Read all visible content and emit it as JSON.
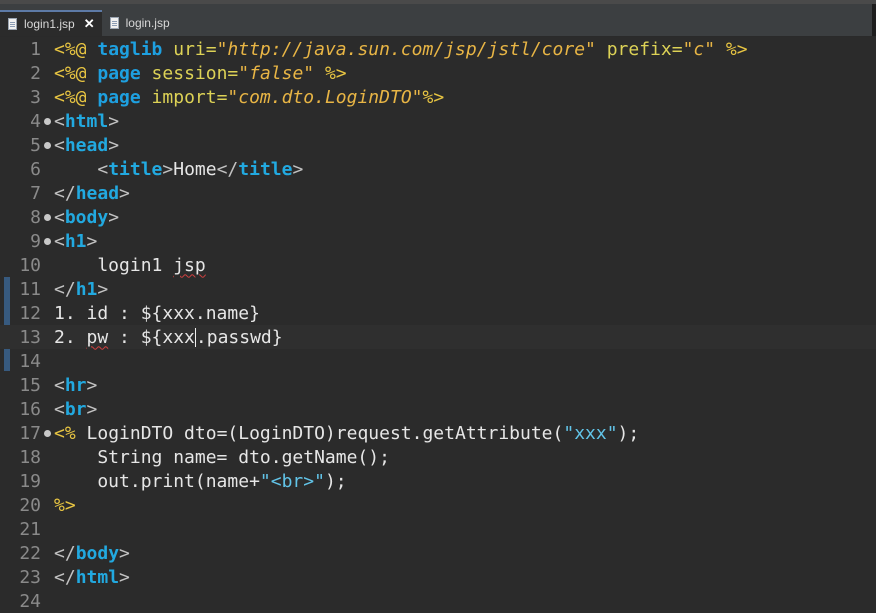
{
  "tabs": [
    {
      "label": "login1.jsp",
      "active": true,
      "close": "✕"
    },
    {
      "label": "login.jsp",
      "active": false
    }
  ],
  "colors": {
    "background": "#2b2b2b",
    "line_numbers": "#8a8a8a",
    "tag_keyword": "#22a9e0",
    "jsp_delimiter": "#e8c542",
    "attribute_value": "#e8b545"
  },
  "lines": [
    {
      "n": "1",
      "fold": false,
      "tokens": [
        [
          "t-jsp",
          "<%@ "
        ],
        [
          "t-kw",
          "taglib"
        ],
        [
          "t-attr",
          " uri="
        ],
        [
          "t-str",
          "\"http://java.sun.com/jsp/jstl/core\""
        ],
        [
          "t-attr",
          " prefix="
        ],
        [
          "t-str",
          "\"c\""
        ],
        [
          "t-jsp",
          " %>"
        ]
      ]
    },
    {
      "n": "2",
      "fold": false,
      "tokens": [
        [
          "t-jsp",
          "<%@ "
        ],
        [
          "t-kw",
          "page"
        ],
        [
          "t-attr",
          " session="
        ],
        [
          "t-str",
          "\"false\""
        ],
        [
          "t-jsp",
          " %>"
        ]
      ]
    },
    {
      "n": "3",
      "fold": false,
      "tokens": [
        [
          "t-jsp",
          "<%@ "
        ],
        [
          "t-kw",
          "page"
        ],
        [
          "t-attr",
          " import="
        ],
        [
          "t-str",
          "\"com.dto.LoginDTO\""
        ],
        [
          "t-jsp",
          "%>"
        ]
      ]
    },
    {
      "n": "4",
      "fold": true,
      "tokens": [
        [
          "t-tag",
          "<"
        ],
        [
          "t-el",
          "html"
        ],
        [
          "t-tag",
          ">"
        ]
      ]
    },
    {
      "n": "5",
      "fold": true,
      "tokens": [
        [
          "t-tag",
          "<"
        ],
        [
          "t-el",
          "head"
        ],
        [
          "t-tag",
          ">"
        ]
      ]
    },
    {
      "n": "6",
      "fold": false,
      "tokens": [
        [
          "t-txt",
          "    "
        ],
        [
          "t-tag",
          "<"
        ],
        [
          "t-el",
          "title"
        ],
        [
          "t-tag",
          ">"
        ],
        [
          "t-txt",
          "Home"
        ],
        [
          "t-tag",
          "</"
        ],
        [
          "t-el",
          "title"
        ],
        [
          "t-tag",
          ">"
        ]
      ]
    },
    {
      "n": "7",
      "fold": false,
      "tokens": [
        [
          "t-tag",
          "</"
        ],
        [
          "t-el",
          "head"
        ],
        [
          "t-tag",
          ">"
        ]
      ]
    },
    {
      "n": "8",
      "fold": true,
      "tokens": [
        [
          "t-tag",
          "<"
        ],
        [
          "t-el",
          "body"
        ],
        [
          "t-tag",
          ">"
        ]
      ]
    },
    {
      "n": "9",
      "fold": true,
      "tokens": [
        [
          "t-tag",
          "<"
        ],
        [
          "t-el",
          "h1"
        ],
        [
          "t-tag",
          ">"
        ]
      ]
    },
    {
      "n": "10",
      "fold": false,
      "tokens": [
        [
          "t-txt",
          "    login1 "
        ],
        [
          "t-txt squig",
          "jsp"
        ]
      ]
    },
    {
      "n": "11",
      "fold": false,
      "tokens": [
        [
          "t-tag",
          "</"
        ],
        [
          "t-el",
          "h1"
        ],
        [
          "t-tag",
          ">"
        ]
      ]
    },
    {
      "n": "12",
      "fold": false,
      "tokens": [
        [
          "t-txt",
          "1. id : ${xxx.name}"
        ]
      ]
    },
    {
      "n": "13",
      "fold": false,
      "current": true,
      "tokens": [
        [
          "t-txt",
          "2. "
        ],
        [
          "t-txt squig",
          "pw"
        ],
        [
          "t-txt",
          " : ${xxx"
        ],
        [
          "caret",
          ""
        ],
        [
          "t-txt",
          ".passwd}"
        ]
      ]
    },
    {
      "n": "14",
      "fold": false,
      "tokens": []
    },
    {
      "n": "15",
      "fold": false,
      "tokens": [
        [
          "t-tag",
          "<"
        ],
        [
          "t-el",
          "hr"
        ],
        [
          "t-tag",
          ">"
        ]
      ]
    },
    {
      "n": "16",
      "fold": false,
      "tokens": [
        [
          "t-tag",
          "<"
        ],
        [
          "t-el",
          "br"
        ],
        [
          "t-tag",
          ">"
        ]
      ]
    },
    {
      "n": "17",
      "fold": true,
      "tokens": [
        [
          "t-jsp",
          "<%"
        ],
        [
          "t-java",
          " LoginDTO dto=(LoginDTO)request.getAttribute("
        ],
        [
          "t-jstr",
          "\"xxx\""
        ],
        [
          "t-java",
          ");"
        ]
      ]
    },
    {
      "n": "18",
      "fold": false,
      "tokens": [
        [
          "t-java",
          "    String name= dto.getName();"
        ]
      ]
    },
    {
      "n": "19",
      "fold": false,
      "tokens": [
        [
          "t-java",
          "    out.print(name+"
        ],
        [
          "t-jstr",
          "\"<br>\""
        ],
        [
          "t-java",
          ");"
        ]
      ]
    },
    {
      "n": "20",
      "fold": false,
      "tokens": [
        [
          "t-jsp",
          "%>"
        ]
      ]
    },
    {
      "n": "21",
      "fold": false,
      "tokens": []
    },
    {
      "n": "22",
      "fold": false,
      "tokens": [
        [
          "t-tag",
          "</"
        ],
        [
          "t-el",
          "body"
        ],
        [
          "t-tag",
          ">"
        ]
      ]
    },
    {
      "n": "23",
      "fold": false,
      "tokens": [
        [
          "t-tag",
          "</"
        ],
        [
          "t-el",
          "html"
        ],
        [
          "t-tag",
          ">"
        ]
      ]
    },
    {
      "n": "24",
      "fold": false,
      "tokens": []
    }
  ]
}
